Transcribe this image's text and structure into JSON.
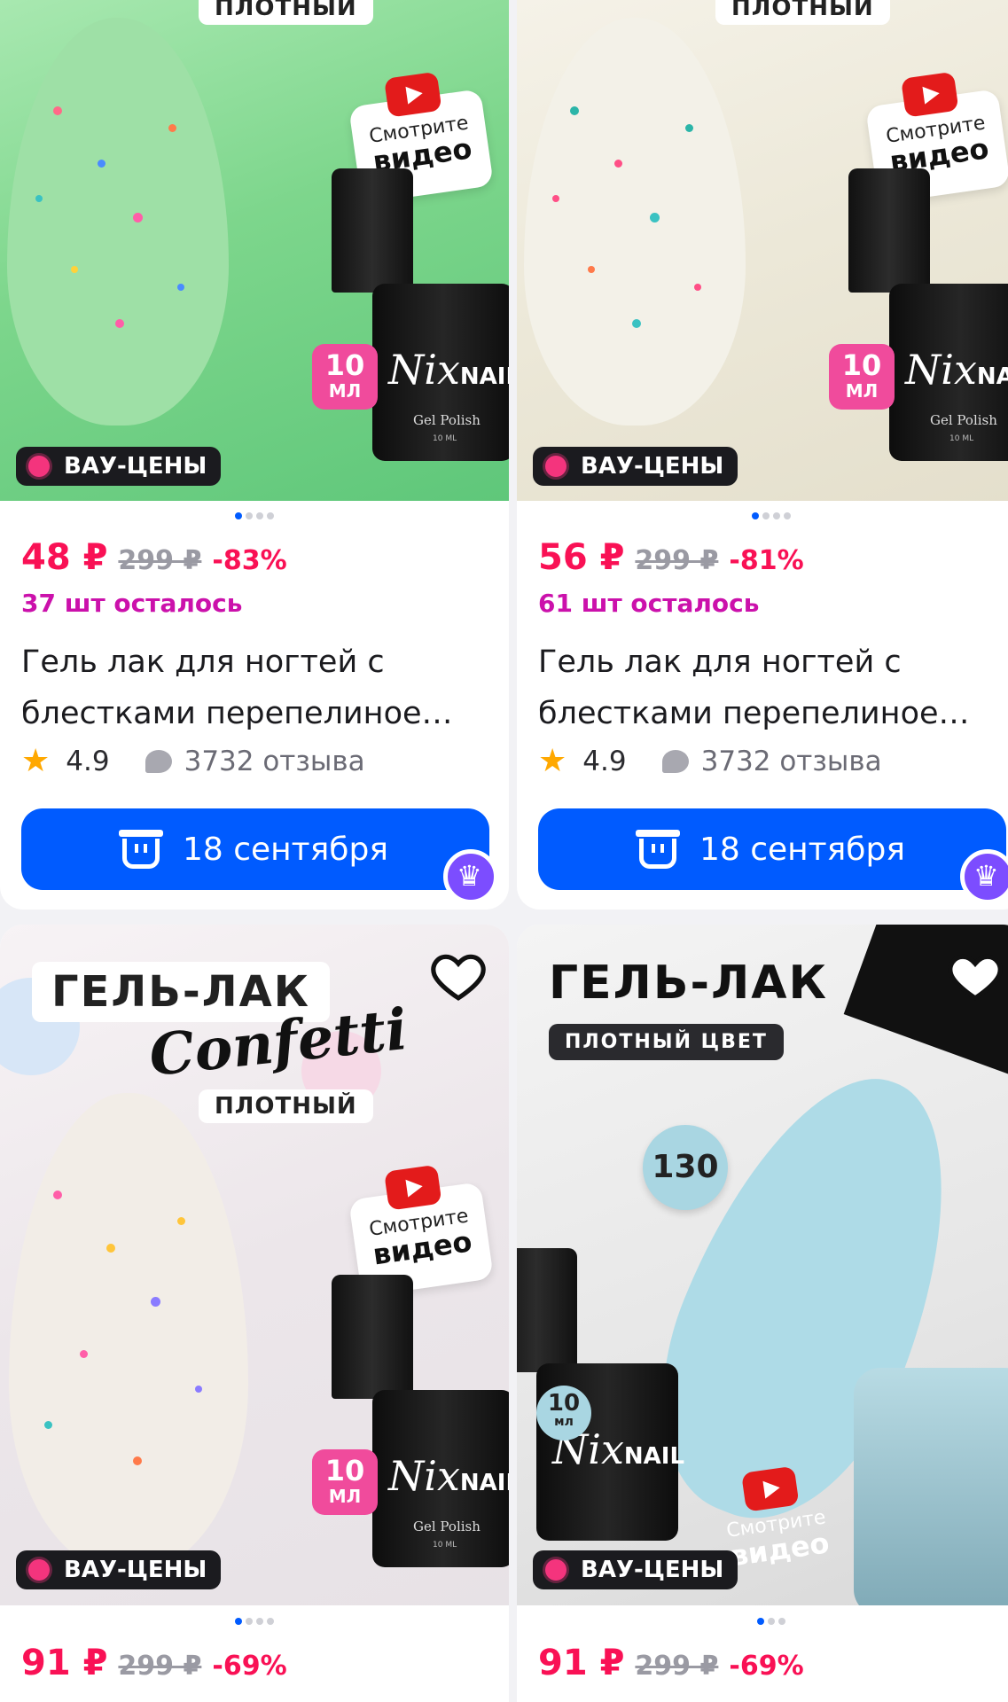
{
  "products": [
    {
      "plain_tag": "ПЛОТНЫЙ",
      "video_line1": "Смотрите",
      "video_line2": "видео",
      "volume_num": "10",
      "volume_unit": "МЛ",
      "brand": "Nix",
      "brand_suffix": "NAIL",
      "bottle_text": "Gel Polish",
      "bottle_ml": "10 ML",
      "promo_badge": "ВАУ-ЦЕНЫ",
      "price": "48 ₽",
      "old_price": "299 ₽",
      "discount": "-83%",
      "stock": "37 шт осталось",
      "title_line1": "Гель лак для ногтей с",
      "title_line2": "блестками перепелиное…",
      "rating": "4.9",
      "reviews": "3732 отзыва",
      "delivery": "18 сентября"
    },
    {
      "plain_tag": "ПЛОТНЫЙ",
      "video_line1": "Смотрите",
      "video_line2": "видео",
      "volume_num": "10",
      "volume_unit": "МЛ",
      "brand": "Nix",
      "brand_suffix": "NAI",
      "bottle_text": "Gel Polish",
      "bottle_ml": "10 ML",
      "promo_badge": "ВАУ-ЦЕНЫ",
      "price": "56 ₽",
      "old_price": "299 ₽",
      "discount": "-81%",
      "stock": "61 шт осталось",
      "title_line1": "Гель лак для ногтей с",
      "title_line2": "блестками перепелиное…",
      "rating": "4.9",
      "reviews": "3732 отзыва",
      "delivery": "18 сентября"
    },
    {
      "headline": "ГЕЛЬ-ЛАК",
      "script_title": "Confetti",
      "plain_tag": "ПЛОТНЫЙ",
      "video_line1": "Смотрите",
      "video_line2": "видео",
      "volume_num": "10",
      "volume_unit": "МЛ",
      "brand": "Nix",
      "brand_suffix": "NAIL",
      "bottle_text": "Gel Polish",
      "bottle_ml": "10 ML",
      "promo_badge": "ВАУ-ЦЕНЫ",
      "price": "91 ₽",
      "old_price": "299 ₽",
      "discount": "-69%"
    },
    {
      "headline": "ГЕЛЬ-ЛАК",
      "chip": "ПЛОТНЫЙ ЦВЕТ",
      "shade_number": "130",
      "volume_num": "10",
      "volume_unit": "мл",
      "brand": "Nix",
      "brand_suffix": "NAIL",
      "video_line1": "Смотрите",
      "video_line2": "видео",
      "promo_badge": "ВАУ-ЦЕНЫ",
      "price": "91 ₽",
      "old_price": "299 ₽",
      "discount": "-69%"
    }
  ],
  "colors": {
    "price": "#f91155",
    "stock": "#cb11ab",
    "button": "#005bff",
    "pager_active": "#005bff"
  },
  "icons": [
    "star-icon",
    "review-bubble-icon",
    "basket-icon",
    "crown-icon",
    "heart-icon",
    "youtube-play-icon",
    "burst-icon"
  ]
}
